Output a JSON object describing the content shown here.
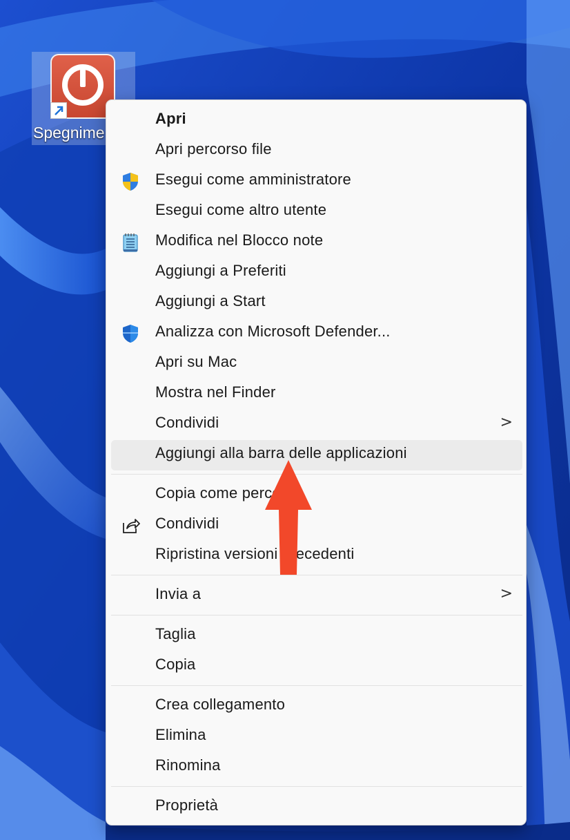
{
  "desktop": {
    "icon_label": "Spegnime",
    "icon_name": "power-icon",
    "shortcut_icon": "shortcut-arrow-icon"
  },
  "menu": {
    "items": [
      {
        "label": "Apri",
        "bold": true
      },
      {
        "label": "Apri percorso file"
      },
      {
        "label": "Esegui come amministratore",
        "icon": "uac-shield-icon"
      },
      {
        "label": "Esegui come altro utente"
      },
      {
        "label": "Modifica nel Blocco note",
        "icon": "notepad-icon"
      },
      {
        "label": "Aggiungi a Preferiti"
      },
      {
        "label": "Aggiungi a Start"
      },
      {
        "label": "Analizza con Microsoft Defender...",
        "icon": "defender-shield-icon"
      },
      {
        "label": "Apri su Mac"
      },
      {
        "label": "Mostra nel Finder"
      },
      {
        "label": "Condividi",
        "submenu": true,
        "chevron": ">"
      },
      {
        "label": "Aggiungi alla barra delle applicazioni",
        "highlighted": true
      },
      {
        "label": "Copia come percorso"
      },
      {
        "label": "Condividi",
        "icon": "share-icon"
      },
      {
        "label": "Ripristina versioni precedenti"
      },
      {
        "label": "Invia a",
        "submenu": true,
        "chevron": ">"
      },
      {
        "label": "Taglia"
      },
      {
        "label": "Copia"
      },
      {
        "label": "Crea collegamento"
      },
      {
        "label": "Elimina"
      },
      {
        "label": "Rinomina"
      },
      {
        "label": "Proprietà"
      }
    ]
  },
  "annotation": {
    "arrow_color": "#f2482a",
    "points_to": "Aggiungi alla barra delle applicazioni"
  },
  "colors": {
    "menu_bg": "#f9f9f9",
    "highlight_bg": "#ebebeb",
    "wallpaper_base": "#0b2f8c"
  }
}
